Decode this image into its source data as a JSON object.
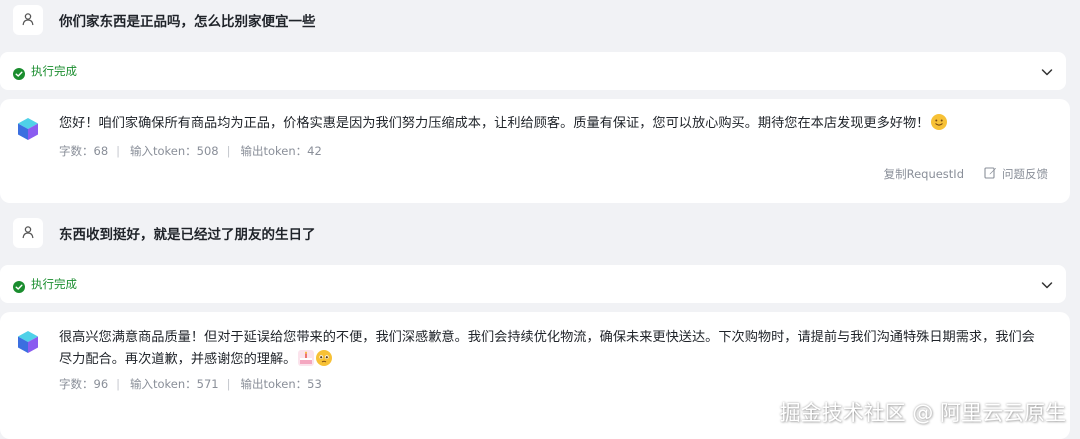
{
  "conversation": [
    {
      "user": {
        "text": "你们家东西是正品吗，怎么比别家便宜一些"
      },
      "status": {
        "label": "执行完成"
      },
      "reply": {
        "text": "您好！咱们家确保所有商品均为正品，价格实惠是因为我们努力压缩成本，让利给顾客。质量有保证，您可以放心购买。期待您在本店发现更多好物！",
        "emoji_icons": [
          "smiling-face-emoji"
        ],
        "stats": {
          "chars": "字数：68",
          "input_tokens": "输入token：508",
          "output_tokens": "输出token：42"
        },
        "actions": {
          "copy_request_id": "复制RequestId",
          "feedback": "问题反馈"
        }
      }
    },
    {
      "user": {
        "text": "东西收到挺好，就是已经过了朋友的生日了"
      },
      "status": {
        "label": "执行完成"
      },
      "reply": {
        "text": "很高兴您满意商品质量！但对于延误给您带来的不便，我们深感歉意。我们会持续优化物流，确保未来更快送达。下次购物时，请提前与我们沟通特殊日期需求，我们会尽力配合。再次道歉，并感谢您的理解。",
        "emoji_icons": [
          "birthday-cake-emoji",
          "pleading-face-emoji"
        ],
        "stats": {
          "chars": "字数：96",
          "input_tokens": "输入token：571",
          "output_tokens": "输出token：53"
        }
      }
    }
  ],
  "watermark": "掘金技术社区 @ 阿里云云原生",
  "colors": {
    "page_bg": "#f1f2f5",
    "card_bg": "#ffffff",
    "success": "#1a8d2e",
    "muted_text": "#8a8f99"
  }
}
